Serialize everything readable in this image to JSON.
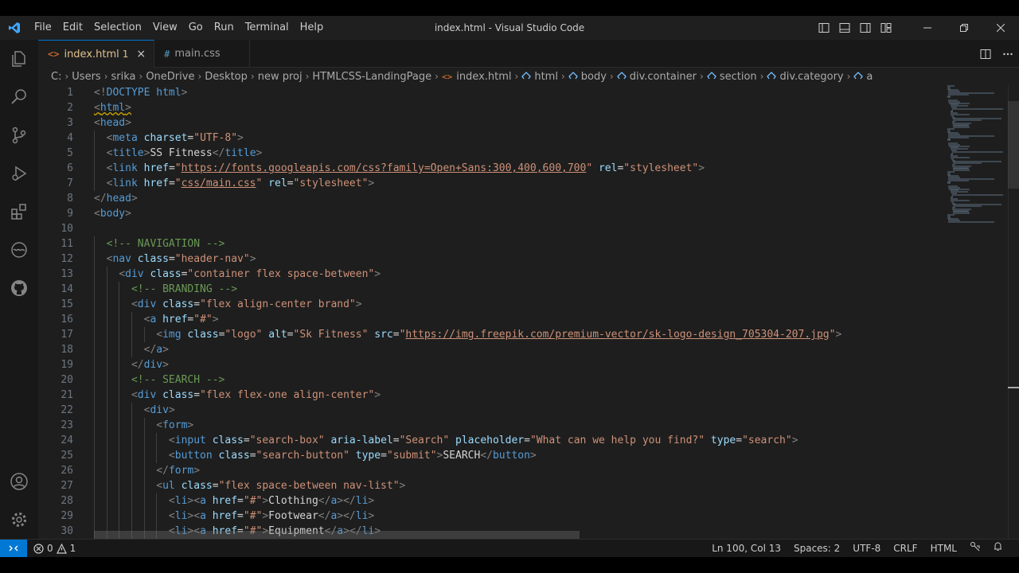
{
  "window": {
    "title": "index.html - Visual Studio Code"
  },
  "menu": [
    "File",
    "Edit",
    "Selection",
    "View",
    "Go",
    "Run",
    "Terminal",
    "Help"
  ],
  "tabs": [
    {
      "icon": "<>",
      "label": "index.html",
      "badge": "1",
      "close": "×"
    },
    {
      "icon": "#",
      "label": "main.css"
    }
  ],
  "breadcrumb": [
    "C:",
    "Users",
    "srika",
    "OneDrive",
    "Desktop",
    "new proj",
    "HTMLCSS-LandingPage",
    "index.html",
    "html",
    "body",
    "div.container",
    "section",
    "div.category",
    "a"
  ],
  "line_numbers": [
    "1",
    "2",
    "3",
    "4",
    "5",
    "6",
    "7",
    "8",
    "9",
    "10",
    "11",
    "12",
    "13",
    "14",
    "15",
    "16",
    "17",
    "18",
    "19",
    "20",
    "21",
    "22",
    "23",
    "24",
    "25",
    "26",
    "27",
    "28",
    "29",
    "30"
  ],
  "code_lines": [
    "<!DOCTYPE html>",
    "<html>",
    "<head>",
    "  <meta charset=\"UTF-8\">",
    "  <title>SS Fitness</title>",
    "  <link href=\"https://fonts.googleapis.com/css?family=Open+Sans:300,400,600,700\" rel=\"stylesheet\">",
    "  <link href=\"css/main.css\" rel=\"stylesheet\">",
    "</head>",
    "<body>",
    "",
    "  <!-- NAVIGATION -->",
    "  <nav class=\"header-nav\">",
    "    <div class=\"container flex space-between\">",
    "      <!-- BRANDING -->",
    "      <div class=\"flex align-center brand\">",
    "        <a href=\"#\">",
    "          <img class=\"logo\" alt=\"Sk Fitness\" src=\"https://img.freepik.com/premium-vector/sk-logo-design_705304-207.jpg\">",
    "        </a>",
    "      </div>",
    "      <!-- SEARCH -->",
    "      <div class=\"flex flex-one align-center\">",
    "        <div>",
    "          <form>",
    "            <input class=\"search-box\" aria-label=\"Search\" placeholder=\"What can we help you find?\" type=\"search\">",
    "            <button class=\"search-button\" type=\"submit\">SEARCH</button>",
    "          </form>",
    "          <ul class=\"flex space-between nav-list\">",
    "            <li><a href=\"#\">Clothing</a></li>",
    "            <li><a href=\"#\">Footwear</a></li>",
    "            <li><a href=\"#\">Equipment</a></li>"
  ],
  "status": {
    "errors": "0",
    "warnings": "1",
    "position": "Ln 100, Col 13",
    "spaces": "Spaces: 2",
    "encoding": "UTF-8",
    "eol": "CRLF",
    "language": "HTML"
  },
  "colors": {
    "accent": "#0078d4",
    "editor_bg": "#1e1e1e",
    "tag": "#569cd6",
    "attr": "#9cdcfe",
    "string": "#ce9178",
    "comment": "#6a9955"
  }
}
